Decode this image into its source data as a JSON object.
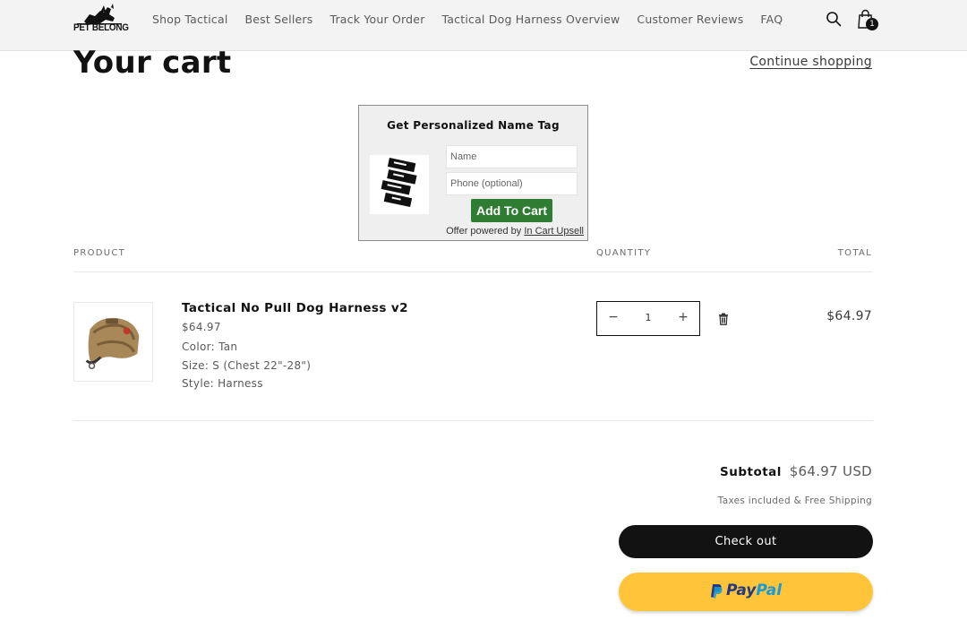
{
  "header": {
    "logo_text": "PET BELONG",
    "nav": [
      "Shop Tactical",
      "Best Sellers",
      "Track Your Order",
      "Tactical Dog Harness Overview",
      "Customer Reviews",
      "FAQ"
    ],
    "cart_count": "1"
  },
  "cart": {
    "title": "Your cart",
    "continue_label": "Continue shopping",
    "columns": {
      "product": "PRODUCT",
      "quantity": "QUANTITY",
      "total": "TOTAL"
    }
  },
  "upsell": {
    "title": "Get Personalized Name Tag",
    "name_placeholder": "Name",
    "phone_placeholder": "Phone (optional)",
    "add_label": "Add To Cart",
    "powered_prefix": "Offer powered by ",
    "powered_link": "In Cart Upsell",
    "accent": "#2e7d32"
  },
  "item": {
    "name": "Tactical No Pull Dog Harness v2",
    "price": "$64.97",
    "color": "Color: Tan",
    "size": "Size: S (Chest 22\"-28\")",
    "style": "Style: Harness",
    "quantity": "1",
    "total": "$64.97"
  },
  "summary": {
    "subtotal_label": "Subtotal",
    "subtotal_value": "$64.97 USD",
    "tax_note": "Taxes included & Free Shipping",
    "checkout_label": "Check out",
    "paypal_a": "Pay",
    "paypal_b": "Pal",
    "paypal_color": "#ffc439"
  },
  "icons": [
    "search-icon",
    "cart-icon",
    "trash-icon",
    "minus-icon",
    "plus-icon",
    "paypal-logo-icon"
  ]
}
